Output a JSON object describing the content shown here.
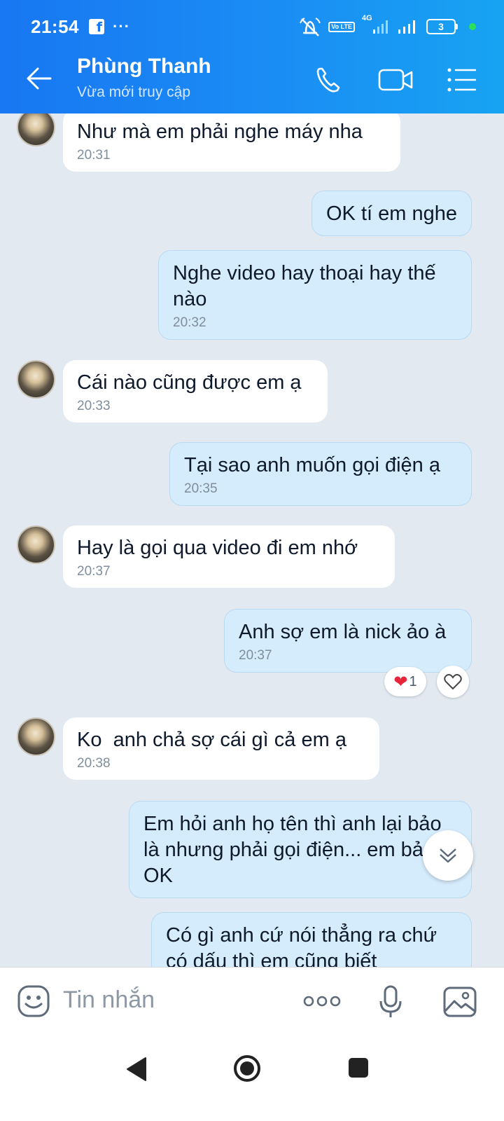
{
  "status_bar": {
    "time": "21:54",
    "volte": "Vo LTE",
    "network": "4G",
    "battery": "3"
  },
  "header": {
    "contact_name": "Phùng Thanh",
    "contact_status": "Vừa mới truy cập"
  },
  "messages": [
    {
      "dir": "in",
      "text": "Như mà em phải nghe máy nha",
      "time": "20:31"
    },
    {
      "dir": "out",
      "text": "OK tí em nghe",
      "time": ""
    },
    {
      "dir": "out",
      "text": "Nghe video hay thoại hay thế nào",
      "time": "20:32"
    },
    {
      "dir": "in",
      "text": "Cái nào cũng được em ạ",
      "time": "20:33"
    },
    {
      "dir": "out",
      "text": "Tại sao anh muốn gọi điện ạ",
      "time": "20:35"
    },
    {
      "dir": "in",
      "text": "Hay là gọi qua video đi em nhớ",
      "time": "20:37"
    },
    {
      "dir": "out",
      "text": "Anh sợ em là nick ảo à",
      "time": "20:37"
    },
    {
      "dir": "in",
      "text": "Ko  anh chả sợ cái gì cả em ạ",
      "time": "20:38"
    },
    {
      "dir": "out",
      "text": "Em hỏi anh họ tên thì anh lại bảo là nhưng phải gọi điện... em bảo OK",
      "time": ""
    },
    {
      "dir": "out",
      "text": "Có gì anh cứ nói thẳng ra chứ có dấu thì em cũng biết",
      "time": ""
    }
  ],
  "reaction": {
    "emoji": "❤",
    "count": "1"
  },
  "input": {
    "placeholder": "Tin nhắn"
  },
  "colors": {
    "header": "#1877f2",
    "bubble_out": "#d5ecfc",
    "bubble_in": "#ffffff",
    "background": "#e2e9f1"
  }
}
